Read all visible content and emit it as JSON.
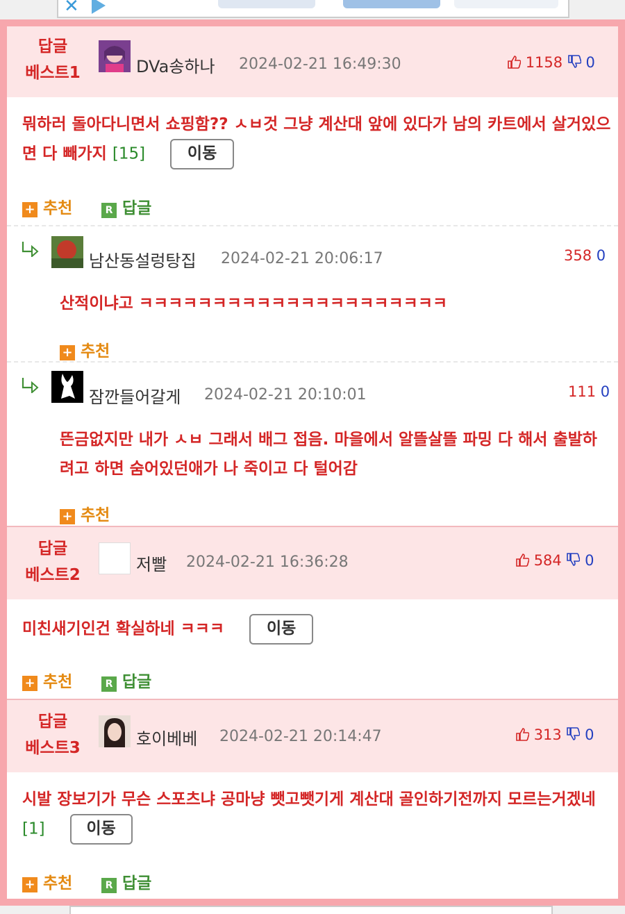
{
  "colors": {
    "accent_red": "#d42626",
    "frame_pink": "#f7a7ad",
    "header_pink": "#fde5e6",
    "vote_blue": "#2440c0",
    "count_green": "#2a8a2a",
    "action_orange": "#e48a12"
  },
  "best": [
    {
      "label_line1": "답글",
      "label_line2": "베스트1",
      "avatar": "anime-girl-avatar",
      "nick": "DVa송하나",
      "date": "2024-02-21 16:49:30",
      "up": "1158",
      "down": "0",
      "text": "뭐하러 돌아다니면서 쇼핑함?? ㅅㅂ것 그냥 계산대 앞에 있다가 남의 카트에서 살거있으면 다 빼가지",
      "count": "[15]",
      "move": "이동",
      "recommend": "추천",
      "reply": "답글",
      "replies": [
        {
          "avatar": "blurry-photo-avatar",
          "nick": "남산동설렁탕집",
          "date": "2024-02-21 20:06:17",
          "up": "358",
          "down": "0",
          "text": "산적이냐고 ㅋㅋㅋㅋㅋㅋㅋㅋㅋㅋㅋㅋㅋㅋㅋㅋㅋㅋㅋㅋㅋ",
          "recommend": "추천"
        },
        {
          "avatar": "bunny-logo-avatar",
          "nick": "잠깐들어갈게",
          "date": "2024-02-21 20:10:01",
          "up": "111",
          "down": "0",
          "text": "뜬금없지만 내가 ㅅㅂ 그래서 배그 접음. 마을에서 알뜰살뜰 파밍 다 해서 출발하려고 하면 숨어있던애가 나 죽이고 다 털어감",
          "recommend": "추천"
        }
      ]
    },
    {
      "label_line1": "답글",
      "label_line2": "베스트2",
      "avatar": "blank-avatar",
      "nick": "저빨",
      "date": "2024-02-21 16:36:28",
      "up": "584",
      "down": "0",
      "text": "미친새기인건 확실하네 ㅋㅋㅋ",
      "move": "이동",
      "recommend": "추천",
      "reply": "답글"
    },
    {
      "label_line1": "답글",
      "label_line2": "베스트3",
      "avatar": "portrait-avatar",
      "nick": "호이베베",
      "date": "2024-02-21 20:14:47",
      "up": "313",
      "down": "0",
      "text": "시발 장보기가 무슨 스포츠냐 공마냥 뺏고뺏기게 계산대 골인하기전까지 모르는거겠네",
      "count": "[1]",
      "move": "이동",
      "recommend": "추천",
      "reply": "답글"
    }
  ]
}
